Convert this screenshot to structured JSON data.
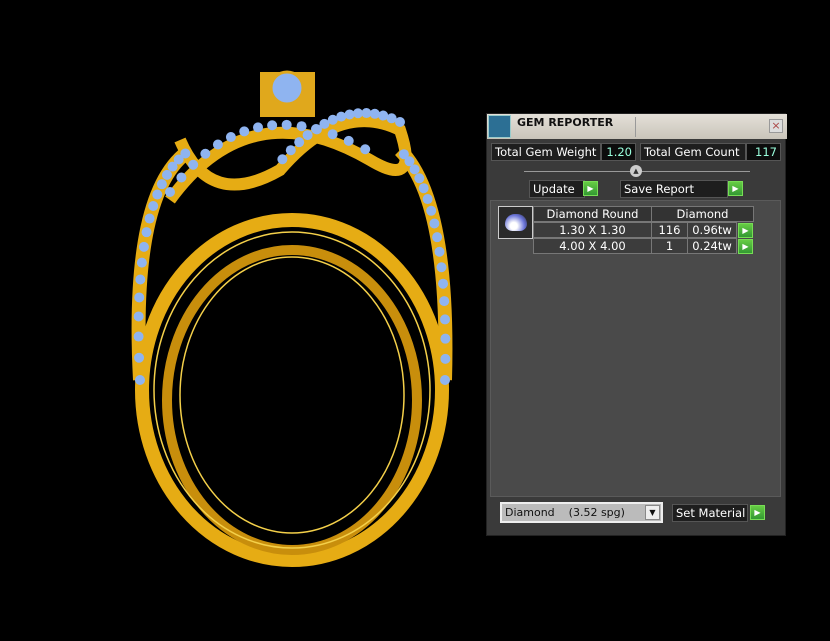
{
  "panel": {
    "title": "GEM REPORTER",
    "close": "×",
    "total_weight_label": "Total Gem Weight",
    "total_weight": "1.20",
    "total_count_label": "Total Gem Count",
    "total_count": "117",
    "update_label": "Update",
    "save_label": "Save Report",
    "table": {
      "header": [
        "Diamond Round",
        "Diamond"
      ],
      "rows": [
        {
          "size": "1.30 X 1.30",
          "count": "116",
          "weight": "0.96tw"
        },
        {
          "size": "4.00 X 4.00",
          "count": "1",
          "weight": "0.24tw"
        }
      ]
    },
    "material": {
      "name": "Diamond",
      "density": "(3.52 spg)"
    },
    "set_material_label": "Set Material"
  },
  "colors": {
    "gold": "#e0a81c",
    "gem": "#8fb4f0",
    "accent": "#44aa33"
  }
}
